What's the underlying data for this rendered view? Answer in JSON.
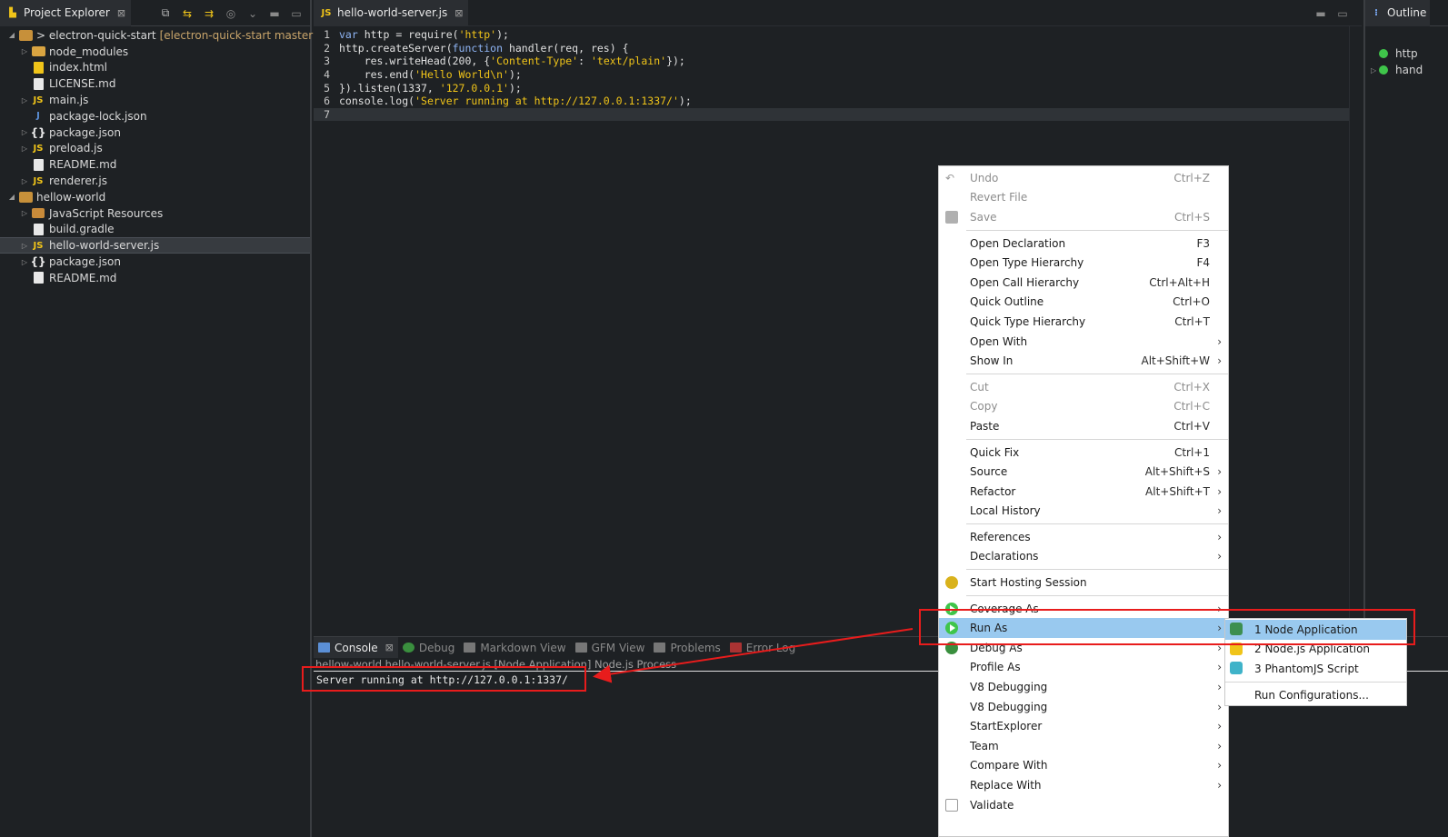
{
  "explorer": {
    "tab_title": "Project Explorer",
    "tab_close": "⊠",
    "items": [
      {
        "label": "> electron-quick-start",
        "branch": "[electron-quick-start master]",
        "icon": "project-icon",
        "twisty": "◢"
      },
      {
        "label": "node_modules",
        "icon": "folder-icon",
        "twisty": "▷"
      },
      {
        "label": "index.html",
        "icon": "html-file-icon",
        "twisty": ""
      },
      {
        "label": "LICENSE.md",
        "icon": "markdown-file-icon",
        "twisty": ""
      },
      {
        "label": "main.js",
        "icon": "js-file-icon",
        "twisty": "▷"
      },
      {
        "label": "package-lock.json",
        "icon": "json-file-icon",
        "twisty": ""
      },
      {
        "label": "package.json",
        "icon": "json-braces-icon",
        "twisty": "▷"
      },
      {
        "label": "preload.js",
        "icon": "js-file-icon",
        "twisty": "▷"
      },
      {
        "label": "README.md",
        "icon": "markdown-file-icon",
        "twisty": ""
      },
      {
        "label": "renderer.js",
        "icon": "js-file-icon",
        "twisty": "▷"
      },
      {
        "label": "hellow-world",
        "icon": "project-icon",
        "twisty": "◢"
      },
      {
        "label": "JavaScript Resources",
        "icon": "js-resources-icon",
        "twisty": "▷"
      },
      {
        "label": "build.gradle",
        "icon": "gradle-file-icon",
        "twisty": ""
      },
      {
        "label": "hello-world-server.js",
        "icon": "js-file-icon",
        "twisty": "▷"
      },
      {
        "label": "package.json",
        "icon": "json-braces-icon",
        "twisty": "▷"
      },
      {
        "label": "README.md",
        "icon": "markdown-file-icon",
        "twisty": ""
      }
    ]
  },
  "editor": {
    "tab_title": "hello-world-server.js",
    "tab_close": "⊠",
    "lines": [
      {
        "n": "1"
      },
      {
        "n": "2"
      },
      {
        "n": "3"
      },
      {
        "n": "4"
      },
      {
        "n": "5"
      },
      {
        "n": "6"
      },
      {
        "n": "7"
      }
    ]
  },
  "outline": {
    "tab_title": "Outline",
    "items": [
      "http",
      "hand"
    ]
  },
  "console": {
    "tabs": [
      "Console",
      "Debug",
      "Markdown View",
      "GFM View",
      "Problems",
      "Error Log"
    ],
    "description": "hellow-world hello-world-server.js [Node Application] Node.js Process",
    "output": "Server running at http://127.0.0.1:1337/"
  },
  "context_menu": {
    "groups": [
      [
        {
          "label": "Undo",
          "accel": "Ctrl+Z",
          "disabled": true,
          "icon": "undo-icon"
        },
        {
          "label": "Revert File",
          "accel": "",
          "disabled": true
        },
        {
          "label": "Save",
          "accel": "Ctrl+S",
          "disabled": true,
          "icon": "save-icon"
        }
      ],
      [
        {
          "label": "Open Declaration",
          "accel": "F3"
        },
        {
          "label": "Open Type Hierarchy",
          "accel": "F4"
        },
        {
          "label": "Open Call Hierarchy",
          "accel": "Ctrl+Alt+H"
        },
        {
          "label": "Quick Outline",
          "accel": "Ctrl+O"
        },
        {
          "label": "Quick Type Hierarchy",
          "accel": "Ctrl+T"
        },
        {
          "label": "Open With",
          "accel": "",
          "submenu": true
        },
        {
          "label": "Show In",
          "accel": "Alt+Shift+W",
          "submenu": true
        }
      ],
      [
        {
          "label": "Cut",
          "accel": "Ctrl+X",
          "disabled": true
        },
        {
          "label": "Copy",
          "accel": "Ctrl+C",
          "disabled": true
        },
        {
          "label": "Paste",
          "accel": "Ctrl+V"
        }
      ],
      [
        {
          "label": "Quick Fix",
          "accel": "Ctrl+1"
        },
        {
          "label": "Source",
          "accel": "Alt+Shift+S",
          "submenu": true
        },
        {
          "label": "Refactor",
          "accel": "Alt+Shift+T",
          "submenu": true
        },
        {
          "label": "Local History",
          "accel": "",
          "submenu": true
        }
      ],
      [
        {
          "label": "References",
          "accel": "",
          "submenu": true
        },
        {
          "label": "Declarations",
          "accel": "",
          "submenu": true
        }
      ],
      [
        {
          "label": "Start Hosting Session",
          "accel": "",
          "icon": "hosting-session-icon"
        }
      ],
      [
        {
          "label": "Coverage As",
          "accel": "",
          "submenu": true,
          "icon": "coverage-icon"
        },
        {
          "label": "Run As",
          "accel": "",
          "submenu": true,
          "icon": "run-icon",
          "highlight": true
        },
        {
          "label": "Debug As",
          "accel": "",
          "submenu": true,
          "icon": "debug-icon"
        },
        {
          "label": "Profile As",
          "accel": "",
          "submenu": true
        },
        {
          "label": "V8 Debugging",
          "accel": "",
          "submenu": true
        },
        {
          "label": "V8 Debugging",
          "accel": "",
          "submenu": true
        },
        {
          "label": "StartExplorer",
          "accel": "",
          "submenu": true
        },
        {
          "label": "Team",
          "accel": "",
          "submenu": true
        },
        {
          "label": "Compare With",
          "accel": "",
          "submenu": true
        },
        {
          "label": "Replace With",
          "accel": "",
          "submenu": true
        },
        {
          "label": "Validate",
          "accel": "",
          "icon": "validate-icon"
        }
      ]
    ]
  },
  "submenu": {
    "items": [
      {
        "label": "1 Node Application",
        "icon": "node-app-icon",
        "highlight": true
      },
      {
        "label": "2 Node.js Application",
        "icon": "nodejs-app-icon"
      },
      {
        "label": "3 PhantomJS Script",
        "icon": "phantomjs-icon"
      }
    ],
    "footer": "Run Configurations..."
  },
  "colors": {
    "menu_highlight": "#99c9ef",
    "annotation_red": "#e81c1c",
    "js_icon": "#f0c419",
    "run_green": "#3fc54a"
  }
}
